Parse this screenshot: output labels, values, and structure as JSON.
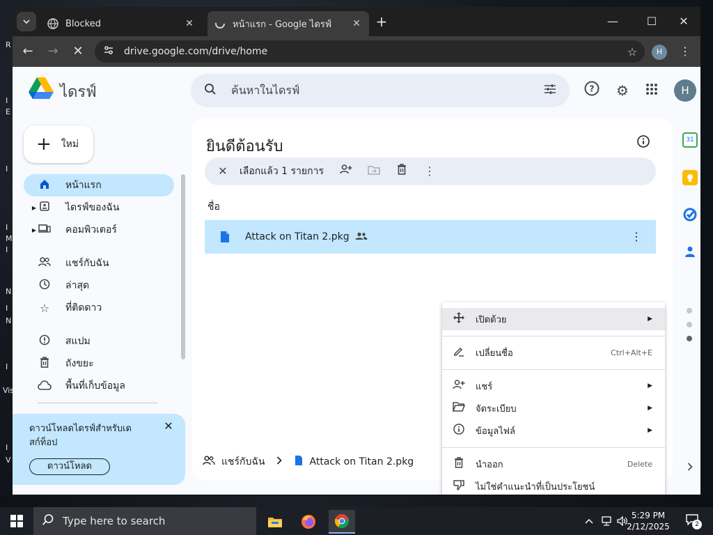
{
  "desktop": {
    "edge_glyphs": [
      "R",
      "I",
      "E",
      "I",
      "I",
      "M",
      "I",
      "N",
      "I",
      "N",
      "I",
      "Vis",
      "I",
      "V"
    ]
  },
  "browser": {
    "tabs": [
      {
        "title": "Blocked",
        "close": "✕",
        "active": false
      },
      {
        "title": "หน้าแรก - Google ไดรฟ์",
        "close": "✕",
        "active": true
      }
    ],
    "new_tab": "+",
    "window_controls": {
      "minimize": "—",
      "maximize": "☐",
      "close": "✕"
    },
    "url": "drive.google.com/drive/home",
    "profile_initial": "H"
  },
  "drive": {
    "brand": "ไดรฟ์",
    "search_placeholder": "ค้นหาในไดรฟ์",
    "avatar_initial": "H",
    "new_button": "ใหม่",
    "nav": [
      {
        "label": "หน้าแรก",
        "icon": "home-icon",
        "active": true,
        "expandable": false
      },
      {
        "label": "ไดรฟ์ของฉัน",
        "icon": "my-drive-icon",
        "active": false,
        "expandable": true
      },
      {
        "label": "คอมพิวเตอร์",
        "icon": "computers-icon",
        "active": false,
        "expandable": true
      },
      {
        "label": "แชร์กับฉัน",
        "icon": "shared-icon",
        "active": false,
        "expandable": false
      },
      {
        "label": "ล่าสุด",
        "icon": "clock-icon",
        "active": false,
        "expandable": false
      },
      {
        "label": "ที่ติดดาว",
        "icon": "star-icon",
        "active": false,
        "expandable": false
      },
      {
        "label": "สแปม",
        "icon": "spam-icon",
        "active": false,
        "expandable": false
      },
      {
        "label": "ถังขยะ",
        "icon": "trash-icon",
        "active": false,
        "expandable": false
      },
      {
        "label": "พื้นที่เก็บข้อมูล",
        "icon": "cloud-icon",
        "active": false,
        "expandable": false
      }
    ],
    "promo": {
      "text": "ดาวน์โหลดไดรฟ์สำหรับเดสก์ท็อป",
      "button": "ดาวน์โหลด",
      "close": "✕"
    },
    "main": {
      "title": "ยินดีต้อนรับ",
      "selection_text": "เลือกแล้ว 1 รายการ",
      "column_header": "ชื่อ",
      "file": {
        "name": "Attack on Titan 2.pkg"
      },
      "breadcrumb": {
        "folder": "แชร์กับฉัน",
        "file": "Attack on Titan 2.pkg"
      }
    }
  },
  "context_menu": {
    "items": [
      {
        "label": "เปิดด้วย",
        "icon": "open-with-icon",
        "submenu": true,
        "shortcut": "",
        "highlighted": true
      },
      {
        "label": "เปลี่ยนชื่อ",
        "icon": "rename-icon",
        "submenu": false,
        "shortcut": "Ctrl+Alt+E",
        "highlighted": false
      },
      {
        "label": "แชร์",
        "icon": "share-icon",
        "submenu": true,
        "shortcut": "",
        "highlighted": false
      },
      {
        "label": "จัดระเบียบ",
        "icon": "organize-icon",
        "submenu": true,
        "shortcut": "",
        "highlighted": false
      },
      {
        "label": "ข้อมูลไฟล์",
        "icon": "file-info-icon",
        "submenu": true,
        "shortcut": "",
        "highlighted": false
      },
      {
        "label": "นำออก",
        "icon": "remove-icon",
        "submenu": false,
        "shortcut": "Delete",
        "highlighted": false
      },
      {
        "label": "ไม่ใช่คำแนะนำที่เป็นประโยชน์",
        "icon": "not-helpful-icon",
        "submenu": false,
        "shortcut": "",
        "highlighted": false
      }
    ]
  },
  "taskbar": {
    "search_placeholder": "Type here to search",
    "time": "5:29 PM",
    "date": "2/12/2025",
    "notification_count": "2"
  },
  "colors": {
    "accent": "#c2e7ff",
    "search_bg": "#e9eef6",
    "file_icon": "#1a73e8",
    "chrome_dark": "#3c3c3c"
  }
}
